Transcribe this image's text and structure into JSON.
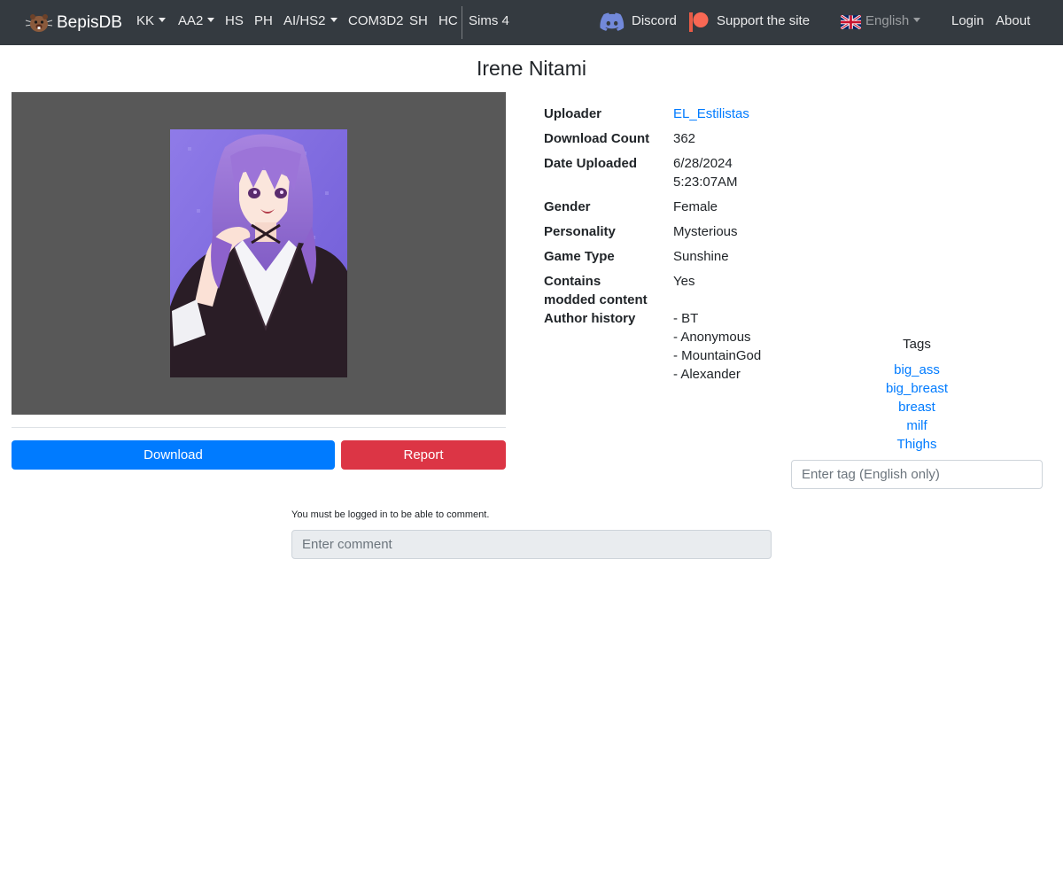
{
  "navbar": {
    "brand": "BepisDB",
    "links": [
      {
        "label": "KK",
        "dropdown": true
      },
      {
        "label": "AA2",
        "dropdown": true
      },
      {
        "label": "HS",
        "dropdown": false
      },
      {
        "label": "PH",
        "dropdown": false
      },
      {
        "label": "AI/HS2",
        "dropdown": true
      },
      {
        "label": "COM3D2",
        "dropdown": false
      },
      {
        "label": "SH",
        "dropdown": false
      },
      {
        "label": "HC",
        "dropdown": false
      },
      {
        "label": "Sims 4",
        "dropdown": false
      }
    ],
    "discord": "Discord",
    "support": "Support the site",
    "language": "English",
    "login": "Login",
    "about": "About",
    "icons": {
      "brand": "bepis-logo-icon",
      "discord": "discord-icon",
      "support": "patreon-icon",
      "language": "uk-flag-icon"
    }
  },
  "card": {
    "title": "Irene Nitami",
    "image_alt": "character card preview"
  },
  "actions": {
    "download": "Download",
    "report": "Report"
  },
  "info": {
    "uploader_label": "Uploader",
    "uploader": "EL_Estilistas",
    "download_count_label": "Download Count",
    "download_count": "362",
    "date_label": "Date Uploaded",
    "date": "6/28/2024",
    "time": "5:23:07AM",
    "gender_label": "Gender",
    "gender": "Female",
    "personality_label": "Personality",
    "personality": "Mysterious",
    "game_type_label": "Game Type",
    "game_type": "Sunshine",
    "modded_label_1": "Contains",
    "modded_label_2": "modded content",
    "modded": "Yes",
    "author_history_label": "Author history",
    "author_history": [
      "- BT",
      "- Anonymous",
      "- MountainGod",
      "- Alexander"
    ]
  },
  "tags": {
    "heading": "Tags",
    "items": [
      "big_ass",
      "big_breast",
      "breast",
      "milf",
      "Thighs"
    ],
    "input_placeholder": "Enter tag (English only)"
  },
  "comments": {
    "note": "You must be logged in to be able to comment.",
    "input_placeholder": "Enter comment"
  },
  "colors": {
    "navbar": "#343a40",
    "primary": "#007bff",
    "danger": "#dc3545",
    "image_panel": "#585858"
  }
}
